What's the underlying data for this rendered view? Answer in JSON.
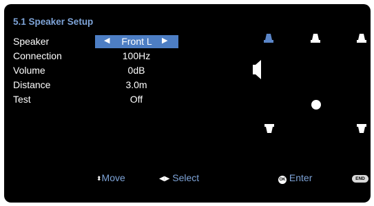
{
  "title": "5.1 Speaker Setup",
  "rows": [
    {
      "label": "Speaker",
      "value": "Front L"
    },
    {
      "label": "Connection",
      "value": "100Hz"
    },
    {
      "label": "Volume",
      "value": "0dB"
    },
    {
      "label": "Distance",
      "value": "3.0m"
    },
    {
      "label": "Test",
      "value": "Off"
    }
  ],
  "footer": {
    "move": "Move",
    "select": "Select",
    "ok_icon": "OK",
    "enter": "Enter",
    "end": "END"
  },
  "colors": {
    "accent": "#7ea4d8",
    "highlight": "#4d7ec4",
    "selected_speaker": "#5b86c9"
  },
  "icons": [
    "left-arrow-icon",
    "right-arrow-icon",
    "speaker-front-icon",
    "speaker-side-icon",
    "speaker-rear-icon",
    "listener-icon",
    "updown-arrow-icon",
    "leftright-arrow-icon",
    "ok-icon"
  ]
}
